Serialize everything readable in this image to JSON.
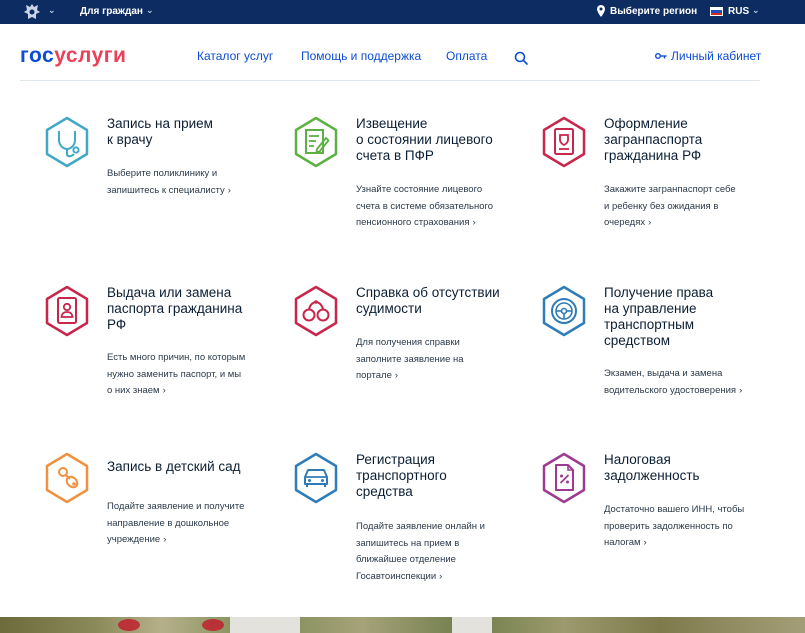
{
  "topbar": {
    "citizens_label": "Для граждан",
    "region_label": "Выберите регион",
    "lang_label": "RUS",
    "flag_colors": [
      "#ffffff",
      "#1f4fb8",
      "#d52b1e"
    ]
  },
  "header": {
    "logo_part1": "гос",
    "logo_part2": "услуги",
    "nav": {
      "catalog": "Каталог услуг",
      "help": "Помощь и поддержка",
      "pay": "Оплата"
    },
    "cabinet_label": "Личный кабинет"
  },
  "colors": {
    "brand_blue": "#0d4cd3",
    "brand_red": "#ee3f58",
    "topbar_bg": "#0d2d62",
    "icon_teal": "#3fa9c6",
    "icon_green": "#5db042",
    "icon_crimson": "#c8264b",
    "icon_blue": "#2f7db8",
    "icon_orange": "#f0913f",
    "icon_purple": "#9c3b91"
  },
  "services": [
    {
      "icon": "stethoscope-icon",
      "title_lines": [
        "Запись на прием",
        "к врачу"
      ],
      "desc_lines": [
        "Выберите поликлинику и",
        "запишитесь к специалисту"
      ]
    },
    {
      "icon": "document-edit-icon",
      "title_lines": [
        "Извещение",
        "о состоянии лицевого",
        "счета в ПФР"
      ],
      "desc_lines": [
        "Узнайте состояние лицевого",
        "счета в системе обязательного",
        "пенсионного страхования"
      ]
    },
    {
      "icon": "passport-icon",
      "title_lines": [
        "Оформление",
        "загранпаспорта",
        "гражданина РФ"
      ],
      "desc_lines": [
        "Закажите загранпаспорт себе",
        "и ребенку без ожидания в",
        "очередях"
      ]
    },
    {
      "icon": "id-card-icon",
      "title_lines": [
        "Выдача или замена",
        "паспорта гражданина",
        "РФ"
      ],
      "desc_lines": [
        "Есть много причин, по которым",
        "нужно заменить паспорт, и мы",
        "о них знаем"
      ]
    },
    {
      "icon": "handcuffs-icon",
      "title_lines": [
        "Справка об отсутствии",
        "судимости"
      ],
      "desc_lines": [
        "Для получения справки",
        "заполните заявление на",
        "портале"
      ]
    },
    {
      "icon": "steering-wheel-icon",
      "title_lines": [
        "Получение права",
        "на управление",
        "транспортным",
        "средством"
      ],
      "desc_lines": [
        "Экзамен, выдача и замена",
        "водительского удостоверения"
      ]
    },
    {
      "icon": "pacifier-icon",
      "title_lines": [
        "Запись в детский сад"
      ],
      "desc_lines": [
        "Подайте заявление и получите",
        "направление в дошкольное",
        "учреждение"
      ]
    },
    {
      "icon": "car-icon",
      "title_lines": [
        "Регистрация",
        "транспортного",
        "средства"
      ],
      "desc_lines": [
        "Подайте заявление онлайн и",
        "запишитесь на прием в",
        "ближайшее отделение",
        "Госавтоинспекции"
      ]
    },
    {
      "icon": "tax-document-icon",
      "title_lines": [
        "Налоговая",
        "задолженность"
      ],
      "desc_lines": [
        "Достаточно вашего ИНН, чтобы",
        "проверить задолженность по",
        "налогам"
      ]
    }
  ]
}
